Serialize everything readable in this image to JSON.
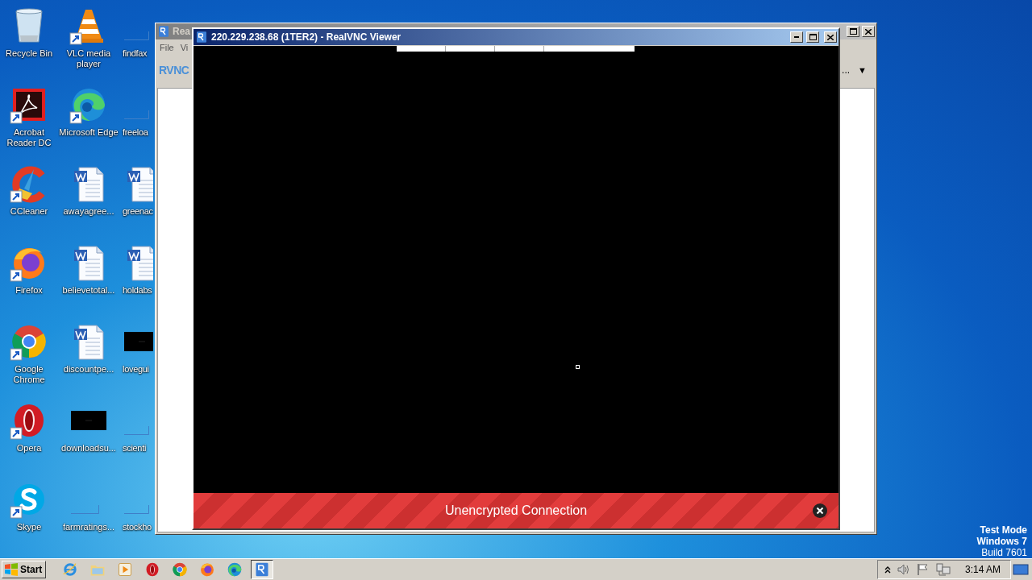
{
  "desktop": {
    "icons": [
      {
        "label": "Recycle Bin",
        "kind": "recycle",
        "shortcut": false
      },
      {
        "label": "Acrobat Reader DC",
        "kind": "acrobat",
        "shortcut": true
      },
      {
        "label": "CCleaner",
        "kind": "ccleaner",
        "shortcut": true
      },
      {
        "label": "Firefox",
        "kind": "firefox",
        "shortcut": true
      },
      {
        "label": "Google Chrome",
        "kind": "chrome",
        "shortcut": true
      },
      {
        "label": "Opera",
        "kind": "opera",
        "shortcut": true
      },
      {
        "label": "Skype",
        "kind": "skype",
        "shortcut": true
      },
      {
        "label": "VLC media player",
        "kind": "vlc",
        "shortcut": true
      },
      {
        "label": "Microsoft Edge",
        "kind": "edge",
        "shortcut": true
      },
      {
        "label": "awayagree...",
        "kind": "word",
        "shortcut": false
      },
      {
        "label": "believetotal...",
        "kind": "word",
        "shortcut": false
      },
      {
        "label": "discountpe...",
        "kind": "word",
        "shortcut": false
      },
      {
        "label": "downloadsu...",
        "kind": "black",
        "shortcut": false
      },
      {
        "label": "farmratings...",
        "kind": "blank",
        "shortcut": false
      },
      {
        "label": "findfax",
        "kind": "blank",
        "shortcut": false
      },
      {
        "label": "freeloa",
        "kind": "blank",
        "shortcut": false
      },
      {
        "label": "greenac",
        "kind": "word",
        "shortcut": false
      },
      {
        "label": "holdabs",
        "kind": "word",
        "shortcut": false
      },
      {
        "label": "lovegui",
        "kind": "black",
        "shortcut": false
      },
      {
        "label": "scienti",
        "kind": "blank",
        "shortcut": false
      },
      {
        "label": "stockho",
        "kind": "blank",
        "shortcut": false
      }
    ]
  },
  "back_window": {
    "title": "Rea",
    "menu": [
      "File",
      "Vi"
    ],
    "logo": "RVNC",
    "overflow": "...",
    "dropdown": "▼"
  },
  "viewer_window": {
    "title": "220.229.238.68 (1TER2) - RealVNC Viewer",
    "banner": "Unencrypted Connection"
  },
  "system_notice": [
    "Test Mode",
    "Windows 7",
    "Build 7601"
  ],
  "taskbar": {
    "start": "Start",
    "apps": [
      {
        "kind": "ie",
        "selected": false
      },
      {
        "kind": "explorer",
        "selected": false
      },
      {
        "kind": "media",
        "selected": false
      },
      {
        "kind": "opera",
        "selected": false
      },
      {
        "kind": "chrome",
        "selected": false
      },
      {
        "kind": "firefox",
        "selected": false
      },
      {
        "kind": "edge",
        "selected": false
      },
      {
        "kind": "vnc",
        "selected": true
      }
    ],
    "clock": "3:14 AM"
  }
}
